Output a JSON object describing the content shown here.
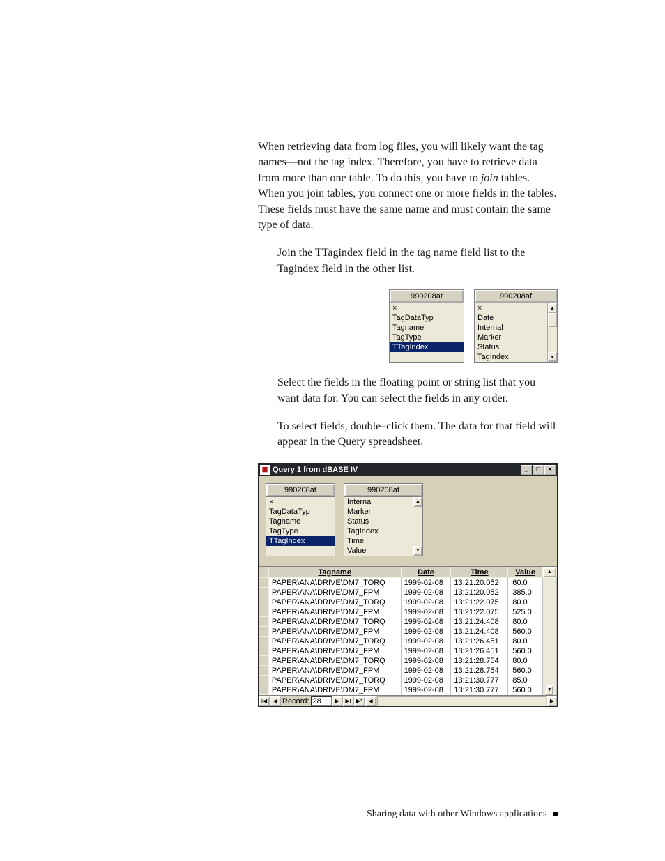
{
  "para1_a": "When retrieving data from log files, you will likely want the tag names—not the tag index. Therefore, you have to retrieve data from more than one table. To do this, you have to ",
  "para1_join": "join",
  "para1_b": " tables. When you join tables, you connect one or more fields in the tables. These fields must have the same name and must contain the same type of data.",
  "para2": "Join the TTagindex field in the tag name field list to the Tagindex field in the other list.",
  "para3": "Select the fields in the floating point or string list that you want data for. You can select the fields in any order.",
  "para4": "To select fields, double–click them. The data for that field will appear in the Query spreadsheet.",
  "footer": "Sharing data with other Windows applications",
  "fig1": {
    "left": {
      "head": "990208at",
      "items": [
        "×",
        "TagDataTyp",
        "Tagname",
        "TagType",
        "TTagIndex"
      ]
    },
    "right": {
      "head": "990208af",
      "items": [
        "×",
        "Date",
        "Internal",
        "Marker",
        "Status",
        "TagIndex"
      ]
    }
  },
  "win": {
    "title": "Query 1 from dBASE IV",
    "left": {
      "head": "990208at",
      "items": [
        "×",
        "TagDataTyp",
        "Tagname",
        "TagType",
        "TTagIndex"
      ]
    },
    "right": {
      "head": "990208af",
      "items": [
        "Internal",
        "Marker",
        "Status",
        "TagIndex",
        "Time",
        "Value"
      ]
    },
    "cols": [
      "Tagname",
      "Date",
      "Time",
      "Value"
    ],
    "record_label": "Record:",
    "record_value": "28"
  },
  "chart_data": {
    "type": "table",
    "columns": [
      "Tagname",
      "Date",
      "Time",
      "Value"
    ],
    "rows": [
      [
        "PAPER\\ANA\\DRIVE\\DM7_TORQ",
        "1999-02-08",
        "13:21:20.052",
        60.0
      ],
      [
        "PAPER\\ANA\\DRIVE\\DM7_FPM",
        "1999-02-08",
        "13:21:20.052",
        385.0
      ],
      [
        "PAPER\\ANA\\DRIVE\\DM7_TORQ",
        "1999-02-08",
        "13:21:22.075",
        80.0
      ],
      [
        "PAPER\\ANA\\DRIVE\\DM7_FPM",
        "1999-02-08",
        "13:21:22.075",
        525.0
      ],
      [
        "PAPER\\ANA\\DRIVE\\DM7_TORQ",
        "1999-02-08",
        "13:21:24.408",
        80.0
      ],
      [
        "PAPER\\ANA\\DRIVE\\DM7_FPM",
        "1999-02-08",
        "13:21:24.408",
        560.0
      ],
      [
        "PAPER\\ANA\\DRIVE\\DM7_TORQ",
        "1999-02-08",
        "13:21:26.451",
        80.0
      ],
      [
        "PAPER\\ANA\\DRIVE\\DM7_FPM",
        "1999-02-08",
        "13:21:26.451",
        560.0
      ],
      [
        "PAPER\\ANA\\DRIVE\\DM7_TORQ",
        "1999-02-08",
        "13:21:28.754",
        80.0
      ],
      [
        "PAPER\\ANA\\DRIVE\\DM7_FPM",
        "1999-02-08",
        "13:21:28.754",
        560.0
      ],
      [
        "PAPER\\ANA\\DRIVE\\DM7_TORQ",
        "1999-02-08",
        "13:21:30.777",
        85.0
      ],
      [
        "PAPER\\ANA\\DRIVE\\DM7_FPM",
        "1999-02-08",
        "13:21:30.777",
        560.0
      ]
    ]
  }
}
